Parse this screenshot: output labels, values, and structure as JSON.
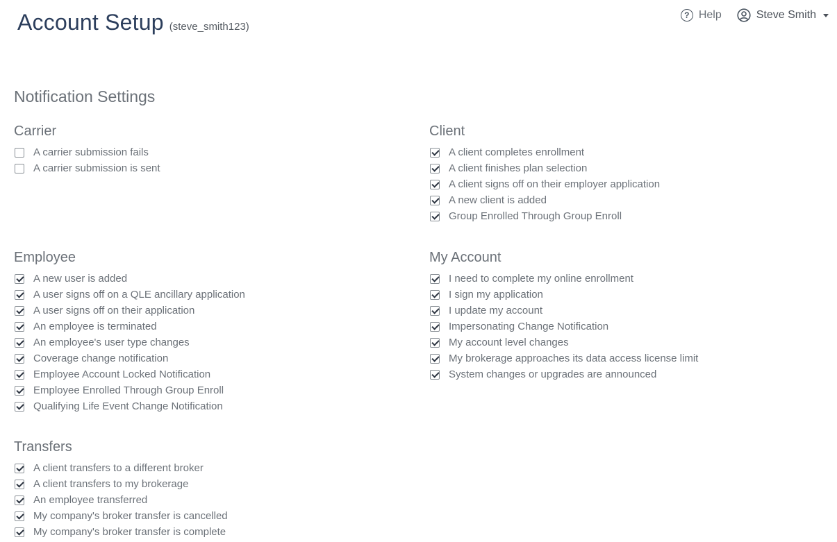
{
  "header": {
    "title": "Account Setup",
    "username": "(steve_smith123)",
    "help_label": "Help",
    "user_name": "Steve Smith"
  },
  "notifications": {
    "title": "Notification Settings",
    "carrier": {
      "heading": "Carrier",
      "items": [
        {
          "label": "A carrier submission fails",
          "checked": false
        },
        {
          "label": "A carrier submission is sent",
          "checked": false
        }
      ]
    },
    "client": {
      "heading": "Client",
      "items": [
        {
          "label": "A client completes enrollment",
          "checked": true
        },
        {
          "label": "A client finishes plan selection",
          "checked": true
        },
        {
          "label": "A client signs off on their employer application",
          "checked": true
        },
        {
          "label": "A new client is added",
          "checked": true
        },
        {
          "label": "Group Enrolled Through Group Enroll",
          "checked": true
        }
      ]
    },
    "employee": {
      "heading": "Employee",
      "items": [
        {
          "label": "A new user is added",
          "checked": true
        },
        {
          "label": "A user signs off on a QLE ancillary application",
          "checked": true
        },
        {
          "label": "A user signs off on their application",
          "checked": true
        },
        {
          "label": "An employee is terminated",
          "checked": true
        },
        {
          "label": "An employee's user type changes",
          "checked": true
        },
        {
          "label": "Coverage change notification",
          "checked": true
        },
        {
          "label": "Employee Account Locked Notification",
          "checked": true
        },
        {
          "label": "Employee Enrolled Through Group Enroll",
          "checked": true
        },
        {
          "label": "Qualifying Life Event Change Notification",
          "checked": true
        }
      ]
    },
    "my_account": {
      "heading": "My Account",
      "items": [
        {
          "label": "I need to complete my online enrollment",
          "checked": true
        },
        {
          "label": "I sign my application",
          "checked": true
        },
        {
          "label": "I update my account",
          "checked": true
        },
        {
          "label": "Impersonating Change Notification",
          "checked": true
        },
        {
          "label": "My account level changes",
          "checked": true
        },
        {
          "label": "My brokerage approaches its data access license limit",
          "checked": true
        },
        {
          "label": "System changes or upgrades are announced",
          "checked": true
        }
      ]
    },
    "transfers": {
      "heading": "Transfers",
      "items": [
        {
          "label": "A client transfers to a different broker",
          "checked": true
        },
        {
          "label": "A client transfers to my brokerage",
          "checked": true
        },
        {
          "label": "An employee transferred",
          "checked": true
        },
        {
          "label": "My company's broker transfer is cancelled",
          "checked": true
        },
        {
          "label": "My company's broker transfer is complete",
          "checked": true
        }
      ]
    }
  },
  "icons": {
    "help": "question-circle-icon",
    "user": "user-circle-icon",
    "caret": "caret-down-icon",
    "checkbox": "checkbox-icon"
  }
}
